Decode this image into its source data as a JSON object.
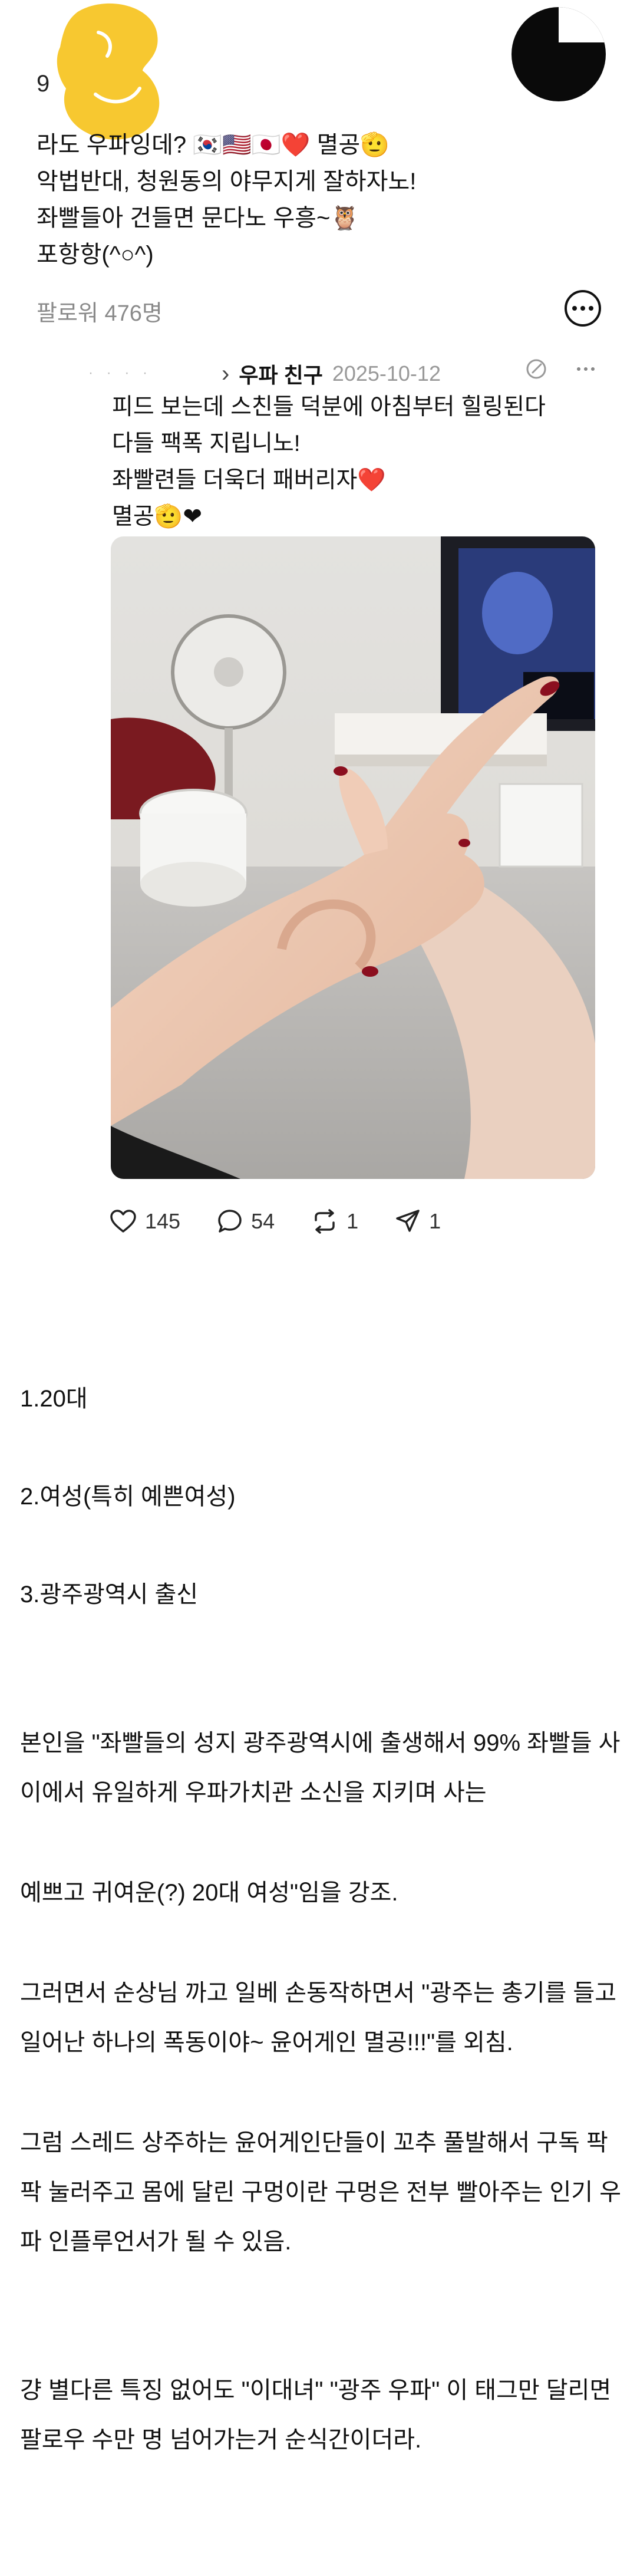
{
  "profile": {
    "followers_small": "9",
    "bio_lines": [
      "라도 우파잉데? 🇰🇷🇺🇸🇯🇵❤️ 멸공🫡",
      "악법반대, 청원동의 야무지게 잘하자노!",
      "좌빨들아 건들면 문다노 우흥~🦉",
      "포항항(^○^)"
    ],
    "followers_label": "팔로워 476명"
  },
  "post": {
    "author": "우파 친구",
    "date": "2025-10-12",
    "body_lines": [
      "피드 보는데 스친들 덕분에 아침부터 힐링된다",
      "다들 팩폭 지립니노!",
      "좌빨련들 더욱더 패버리자❤️",
      "멸공🫡❤"
    ],
    "stats": {
      "likes": "145",
      "comments": "54",
      "reposts": "1",
      "shares": "1"
    }
  },
  "article": {
    "items": [
      "1.20대",
      "2.여성(특히 예쁜여성)",
      "3.광주광역시 출신"
    ],
    "paragraphs": [
      "본인을 \"좌빨들의 성지 광주광역시에 출생해서 99% 좌빨들 사",
      "이에서 유일하게 우파가치관 소신을 지키며 사는",
      "예쁘고 귀여운(?) 20대 여성\"임을 강조.",
      "그러면서 순상님 까고 일베 손동작하면서 \"광주는 총기를 들고",
      "일어난 하나의 폭동이야~ 윤어게인 멸공!!!\"를 외침.",
      "그럼 스레드 상주하는 윤어게인단들이 꼬추 풀발해서 구독 팍",
      "팍 눌러주고 몸에 달린 구멍이란 구멍은 전부 빨아주는 인기 우",
      "파 인플루언서가 될 수 있음.",
      "걍 별다른 특징 없어도 \"이대녀\" \"광주 우파\" 이 태그만 달리면",
      "팔로우 수만 명 넘어가는거 순식간이더라."
    ]
  },
  "colors": {
    "highlight_blob": "#F7C830",
    "muted_text": "#8A8A8A"
  }
}
